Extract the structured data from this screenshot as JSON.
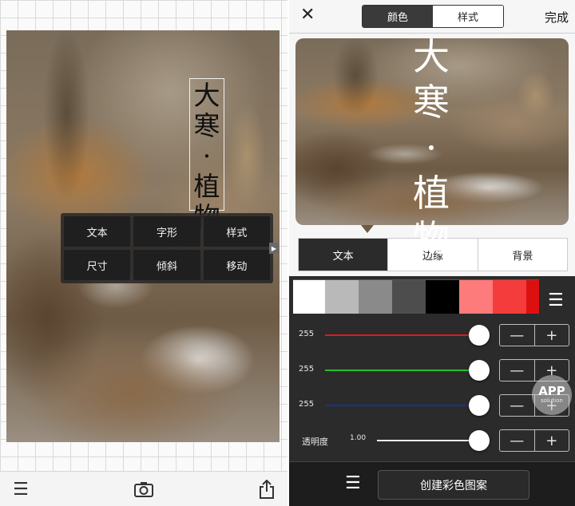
{
  "left": {
    "title_chars": [
      "大",
      "寒",
      "·",
      "植",
      "物"
    ],
    "context_menu": [
      "文本",
      "字形",
      "样式",
      "尺寸",
      "倾斜",
      "移动"
    ],
    "toolbar": {
      "menu_icon": "☰",
      "camera_icon": "📷",
      "share_icon": "⇪"
    }
  },
  "right": {
    "header": {
      "close": "✕",
      "tabs": [
        "颜色",
        "样式"
      ],
      "active_tab": "颜色",
      "done": "完成"
    },
    "preview_title_chars": [
      "大",
      "寒",
      "·",
      "植",
      "物"
    ],
    "text_tabs": [
      "文本",
      "边缘",
      "背景"
    ],
    "active_text_tab": "文本",
    "palette": [
      "#ffffff",
      "#b9b9b9",
      "#8a8a8a",
      "#4d4d4d",
      "#000000",
      "#fd7b7b",
      "#f53c3c",
      "#dd1010"
    ],
    "palette_menu_icon": "☰",
    "sliders": [
      {
        "label": "",
        "value": "255",
        "color": "#e0191e",
        "fraction": 1.0
      },
      {
        "label": "",
        "value": "255",
        "color": "#22c02e",
        "fraction": 1.0
      },
      {
        "label": "",
        "value": "255",
        "color": "#1a2fa0",
        "fraction": 1.0
      },
      {
        "label": "透明度",
        "value": "1.00",
        "color": "#f0f0f0",
        "fraction": 1.0
      }
    ],
    "slider_labels": [
      "255",
      "255",
      "255"
    ],
    "opacity_label": "透明度",
    "opacity_value": "1.00",
    "stepper": {
      "minus": "—",
      "plus": "+"
    },
    "watermark": {
      "big": "APP",
      "small": "solution"
    },
    "bottom": {
      "menu_icon": "☰",
      "create_button": "创建彩色图案"
    }
  }
}
